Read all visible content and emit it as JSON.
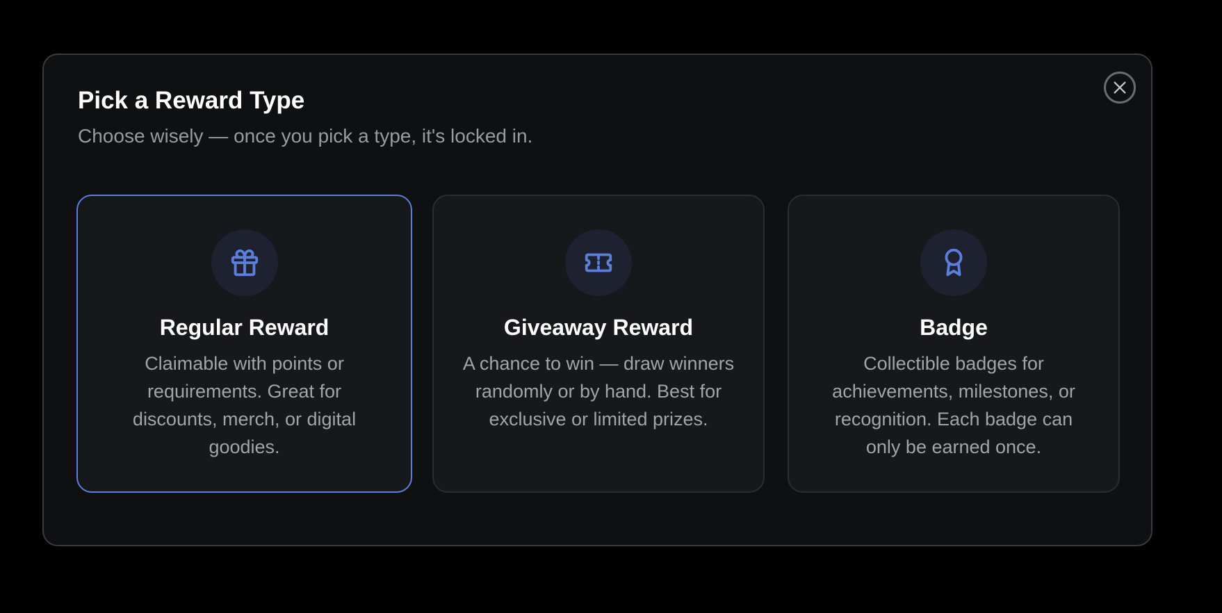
{
  "dialog": {
    "title": "Pick a Reward Type",
    "subtitle": "Choose wisely — once you pick a type, it's locked in.",
    "close_icon": "close-icon"
  },
  "options": [
    {
      "title": "Regular Reward",
      "description": "Claimable with points or requirements. Great for discounts, merch, or digital goodies.",
      "icon": "gift-icon",
      "selected": true
    },
    {
      "title": "Giveaway Reward",
      "description": "A chance to win — draw winners randomly or by hand. Best for exclusive or limited prizes.",
      "icon": "ticket-icon",
      "selected": false
    },
    {
      "title": "Badge",
      "description": "Collectible badges for achievements, milestones, or recognition. Each badge can only be earned once.",
      "icon": "award-icon",
      "selected": false
    }
  ],
  "colors": {
    "accent": "#5b7fdb",
    "background": "#000000",
    "modal_background": "#0f1012",
    "card_background": "#17181b",
    "icon_circle": "#1e2230"
  }
}
